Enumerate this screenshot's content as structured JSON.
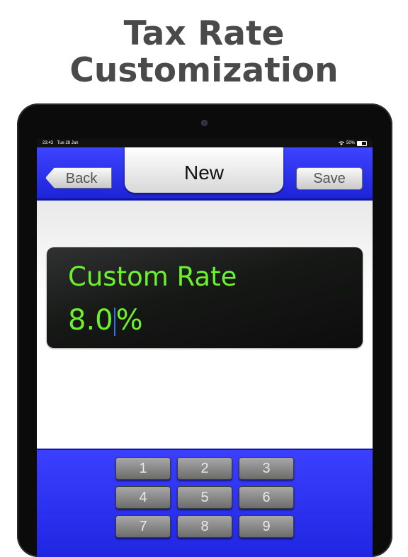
{
  "headline": {
    "line1": "Tax Rate",
    "line2": "Customization"
  },
  "status_bar": {
    "time": "23:43",
    "date": "Tue 28 Jan",
    "battery": "50%"
  },
  "navbar": {
    "back_label": "Back",
    "title": "New",
    "save_label": "Save"
  },
  "rate_card": {
    "label": "Custom Rate",
    "value_before_cursor": "8.0",
    "value_after_cursor": "%"
  },
  "keypad": {
    "keys": [
      "1",
      "2",
      "3",
      "4",
      "5",
      "6",
      "7",
      "8",
      "9"
    ]
  },
  "colors": {
    "navbar_blue": "#2f35f5",
    "rate_green": "#6cf12a"
  }
}
